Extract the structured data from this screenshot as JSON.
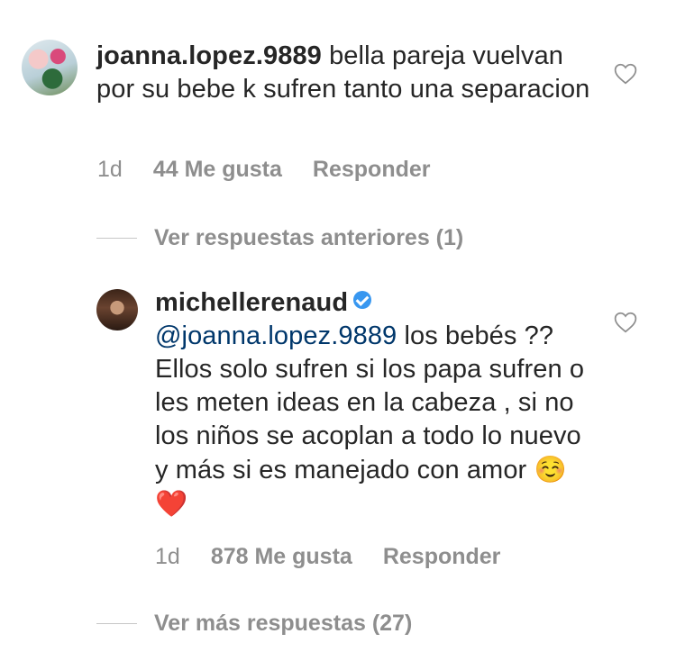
{
  "comments": [
    {
      "username": "joanna.lopez.9889",
      "text": "bella pareja vuelvan por su bebe k sufren tanto una separacion",
      "time": "1d",
      "likes": "44 Me gusta",
      "reply": "Responder",
      "icon": "heart-outline-icon"
    },
    {
      "username": "michellerenaud",
      "verified": true,
      "mention": "@joanna.lopez.9889",
      "text": "los bebés ?? Ellos solo sufren si los papa sufren o les meten ideas en la cabeza , si no los niños se acoplan a todo lo nuevo y más si es manejado con amor",
      "emoji_1": "☺️",
      "emoji_2": "❤️",
      "time": "1d",
      "likes": "878 Me gusta",
      "reply": "Responder",
      "icon": "heart-outline-icon"
    }
  ],
  "replies": {
    "previous": "Ver respuestas anteriores (1)",
    "more": "Ver más respuestas (27)"
  },
  "colors": {
    "text": "#262626",
    "secondary": "#8e8e8e",
    "mention": "#00376b",
    "verified": "#3897f0"
  }
}
